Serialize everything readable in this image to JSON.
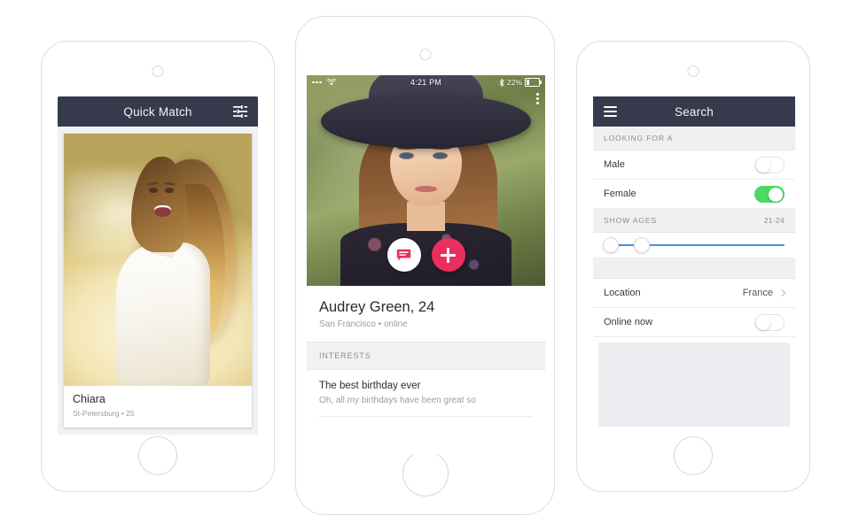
{
  "phone1": {
    "navbar": {
      "title": "Quick Match",
      "filter_icon": "filter-sliders-icon"
    },
    "card": {
      "name": "Chiara",
      "subtitle": "St-Petersburg • 25",
      "photo_alt": "smiling-woman-in-field-photo"
    }
  },
  "phone2": {
    "statusbar": {
      "carrier": "",
      "wifi_icon": "wifi-icon",
      "time": "4:21 PM",
      "bluetooth_icon": "bluetooth-icon",
      "battery_percent": "22%",
      "battery_icon": "battery-icon"
    },
    "overflow_icon": "more-vertical-icon",
    "actions": {
      "message_icon": "message-bubble-icon",
      "add_icon": "plus-icon"
    },
    "profile": {
      "name": "Audrey Green, 24",
      "meta": "San Francisco  •  online",
      "photo_alt": "woman-wearing-wide-brim-hat-photo"
    },
    "section": {
      "header": "INTERESTS",
      "items": [
        {
          "title": "The best birthday ever",
          "body": "Oh, all my birthdays have been great so"
        }
      ]
    }
  },
  "phone3": {
    "navbar": {
      "title": "Search",
      "menu_icon": "hamburger-menu-icon"
    },
    "groups": [
      {
        "header": "LOOKING FOR A",
        "value": "",
        "rows": [
          {
            "label": "Male",
            "type": "toggle",
            "on": false
          },
          {
            "label": "Female",
            "type": "toggle",
            "on": true
          }
        ]
      },
      {
        "header": "SHOW AGES",
        "value": "21-24",
        "slider": {
          "min_percent": 4,
          "max_percent": 21
        }
      },
      {
        "header": "",
        "value": "",
        "rows": [
          {
            "label": "Location",
            "type": "value",
            "value": "France",
            "chevron": true
          },
          {
            "label": "Online now",
            "type": "toggle",
            "on": false
          }
        ]
      }
    ]
  },
  "colors": {
    "navbar": "#353b4c",
    "accent_pink": "#ea2e5d",
    "toggle_on_green": "#4ad964",
    "slider_blue": "#4a90e2"
  }
}
